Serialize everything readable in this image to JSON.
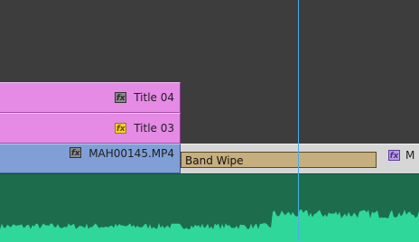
{
  "timeline": {
    "tracks": {
      "title_04": {
        "label": "Title 04",
        "fx_icon": "fx-badge-icon",
        "fx_color": "#8a8a8a"
      },
      "title_03": {
        "label": "Title 03",
        "fx_icon": "fx-badge-icon",
        "fx_color": "#f2d12c"
      },
      "video": {
        "label": "MAH00145.MP4",
        "transition_label": "Band Wipe",
        "next_clip_label": "M"
      }
    },
    "colors": {
      "title_clip": "#e58ae5",
      "video_clip": "#7f9fd6",
      "transition": "#c6ae7e",
      "audio_track": "#1d6d4d",
      "audio_wave": "#2fd79a",
      "playhead": "#4aaeea"
    }
  }
}
